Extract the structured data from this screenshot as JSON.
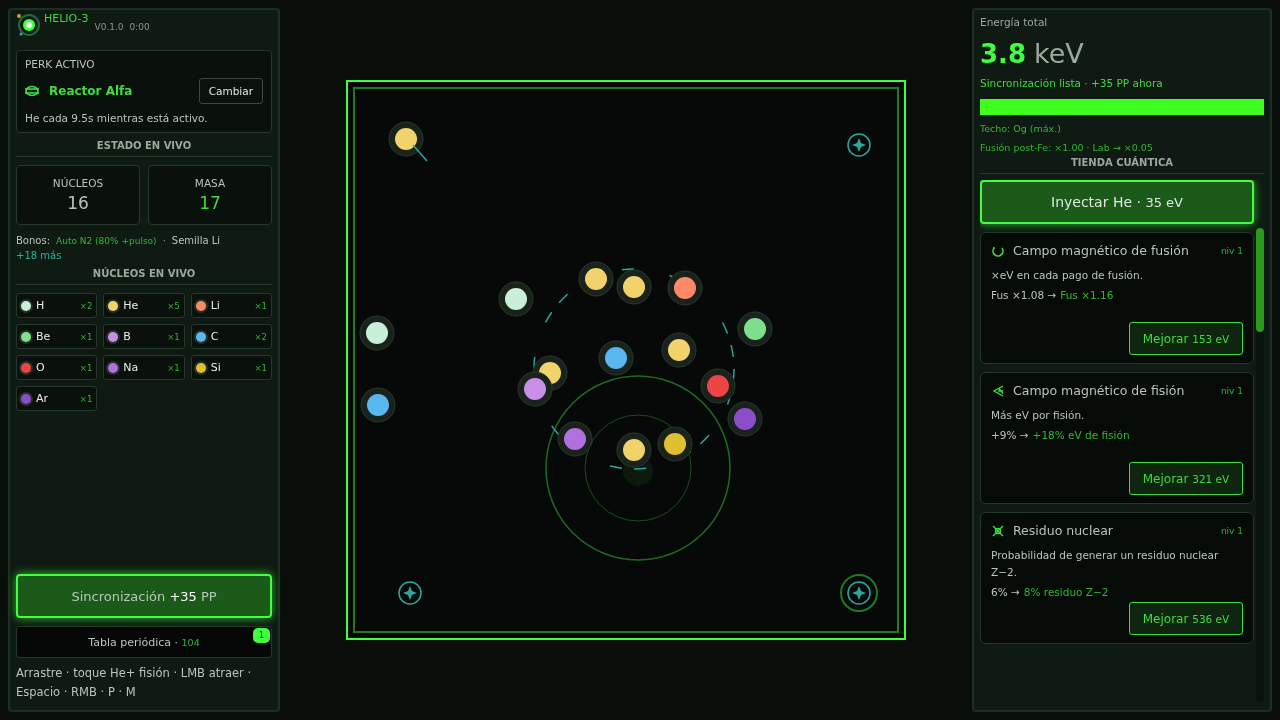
{
  "app": {
    "title": "HELIO-3",
    "version": "V0.1.0",
    "time": "0:00"
  },
  "perk": {
    "heading": "PERK ACTIVO",
    "name": "Reactor Alfa",
    "button": "Cambiar",
    "description": "He cada 9.5s mientras está activo."
  },
  "live_state": {
    "heading": "ESTADO EN VIVO",
    "stats": [
      {
        "label": "NÚCLEOS",
        "value": "16",
        "highlight": false
      },
      {
        "label": "MASA",
        "value": "17",
        "highlight": true
      }
    ]
  },
  "bonuses": {
    "label": "Bonos:",
    "items": [
      {
        "text": "Auto  N2  (80%  +pulso)",
        "kind": "active"
      },
      {
        "text": "Semilla Li",
        "kind": "passive"
      }
    ],
    "separator": "·",
    "more": "+18 más"
  },
  "live_nuclei": {
    "heading": "NÚCLEOS EN VIVO",
    "items": [
      {
        "symbol": "H",
        "count": "×2",
        "color": "#c8f0d8"
      },
      {
        "symbol": "He",
        "count": "×5",
        "color": "#f2d36b"
      },
      {
        "symbol": "Li",
        "count": "×1",
        "color": "#ff8866"
      },
      {
        "symbol": "Be",
        "count": "×1",
        "color": "#7ee08a"
      },
      {
        "symbol": "B",
        "count": "×1",
        "color": "#c88ee8"
      },
      {
        "symbol": "C",
        "count": "×2",
        "color": "#5ab8f0"
      },
      {
        "symbol": "O",
        "count": "×1",
        "color": "#ee4444"
      },
      {
        "symbol": "Na",
        "count": "×1",
        "color": "#b070e0"
      },
      {
        "symbol": "Si",
        "count": "×1",
        "color": "#e0c030"
      },
      {
        "symbol": "Ar",
        "count": "×1",
        "color": "#8a4fc8"
      }
    ]
  },
  "sync_button": {
    "label": "Sincronización **+35** PP"
  },
  "periodic_table": {
    "label": "Tabla periódica ·",
    "count": "104",
    "badge": "1"
  },
  "hint": "Arrastre · toque He+ fisión · LMB atraer · Espacio · RMB · P · M",
  "energy": {
    "label": "Energía total",
    "value": "3.8",
    "unit": "keV",
    "status": "Sincronización lista · +35 PP ahora",
    "level": 1.0,
    "ceiling": "Techo: Og (máx.)",
    "fusion_note": "Fusión post-Fe: ×1.00 · Lab → ×0.05"
  },
  "shop": {
    "heading": "TIENDA CUÁNTICA",
    "inject": {
      "label": "Inyectar He",
      "separator": "·",
      "cost": "35 eV"
    },
    "items": [
      {
        "kind": "fusion",
        "title": "Campo magnético de fusión",
        "level_label": "niv 1",
        "description": "×eV en cada pago de fusión.",
        "current": "Fus ×1.08 →",
        "next": "Fus ×1.16",
        "button": "Mejorar",
        "cost": "153 eV"
      },
      {
        "kind": "fission",
        "title": "Campo magnético de fisión",
        "level_label": "niv 1",
        "description": "Más eV por fisión.",
        "current": "+9% →",
        "next": "+18% eV de fisión",
        "button": "Mejorar",
        "cost": "321 eV"
      },
      {
        "kind": "residue",
        "title": "Residuo nuclear",
        "level_label": "niv 1",
        "description": "Probabilidad de generar un residuo nuclear Z−2.",
        "current": "6% →",
        "next": "8% residuo Z−2",
        "button": "Mejorar",
        "cost": "536 eV"
      }
    ]
  }
}
